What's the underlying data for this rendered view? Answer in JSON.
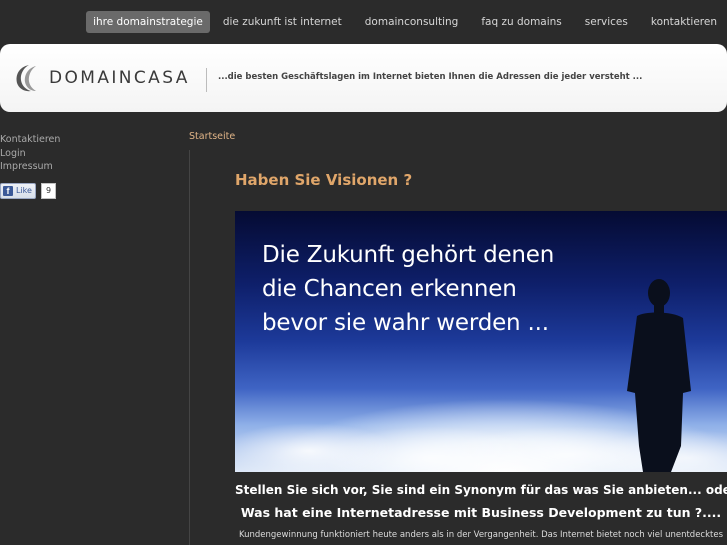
{
  "nav": {
    "items": [
      {
        "label": "ihre domainstrategie",
        "active": true
      },
      {
        "label": "die zukunft ist internet",
        "active": false
      },
      {
        "label": "domainconsulting",
        "active": false
      },
      {
        "label": "faq zu domains",
        "active": false
      },
      {
        "label": "services",
        "active": false
      },
      {
        "label": "kontaktieren",
        "active": false
      }
    ]
  },
  "header": {
    "logo_text": "DOMAINCASA",
    "tagline": "...die besten Geschäftslagen im Internet bieten Ihnen die Adressen die jeder versteht ..."
  },
  "sidebar": {
    "links": [
      "Kontaktieren",
      "Login",
      "Impressum"
    ],
    "like_label": "Like",
    "like_count": "9"
  },
  "breadcrumb": "Startseite",
  "main": {
    "headline": "Haben Sie Visionen ?",
    "hero_lines": [
      "Die Zukunft gehört denen",
      "die Chancen erkennen",
      "bevor sie wahr werden ..."
    ],
    "sub1": "Stellen Sie sich vor, Sie sind ein Synonym für das was Sie anbieten... oder",
    "sub2": "Was hat eine Internetadresse mit Business Development zu tun ?....",
    "body": "Kundengewinnung funktioniert heute anders als in der Vergangenheit. Das Internet bietet noch viel unentdecktes"
  },
  "colors": {
    "background": "#2b2b2b",
    "accent": "#e0a66a",
    "nav_active": "#6a6a6a"
  }
}
